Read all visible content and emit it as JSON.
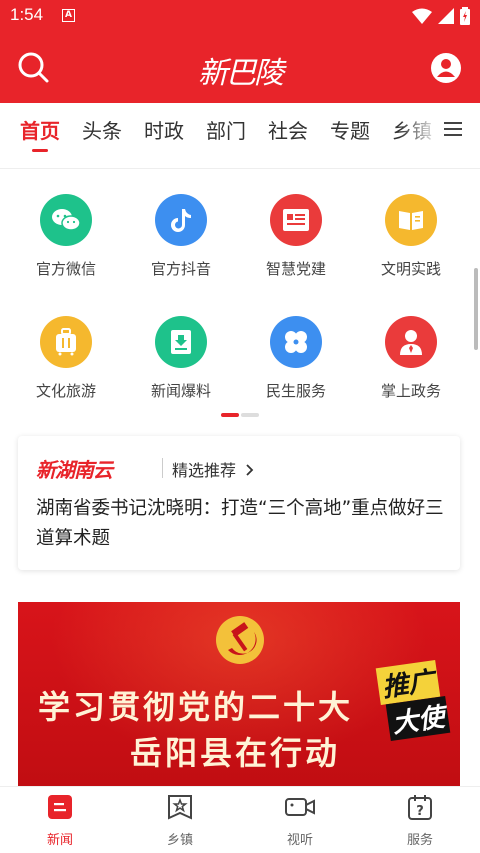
{
  "status_bar": {
    "time": "1:54",
    "notification_icon": "A"
  },
  "header": {
    "logo_text": "新巴陵",
    "search_icon": "search-icon",
    "user_icon": "user-icon",
    "bg_color": "#e8242a"
  },
  "tabs": [
    {
      "label": "首页",
      "active": true
    },
    {
      "label": "头条"
    },
    {
      "label": "时政"
    },
    {
      "label": "部门"
    },
    {
      "label": "社会"
    },
    {
      "label": "专题"
    },
    {
      "label": "乡镇"
    }
  ],
  "grid": [
    {
      "label": "官方微信",
      "icon": "wechat-icon",
      "color": "#1ec28b"
    },
    {
      "label": "官方抖音",
      "icon": "douyin-icon",
      "color": "#3d8ff0"
    },
    {
      "label": "智慧党建",
      "icon": "party-icon",
      "color": "#ea3b3b"
    },
    {
      "label": "文明实践",
      "icon": "book-icon",
      "color": "#f5b82e"
    },
    {
      "label": "文化旅游",
      "icon": "luggage-icon",
      "color": "#f5b82e"
    },
    {
      "label": "新闻爆料",
      "icon": "news-report-icon",
      "color": "#1ec28b"
    },
    {
      "label": "民生服务",
      "icon": "service-icon",
      "color": "#3d8ff0"
    },
    {
      "label": "掌上政务",
      "icon": "government-icon",
      "color": "#ea3b3b"
    }
  ],
  "news_card": {
    "brand": "新湖南云",
    "tag": "精选推荐",
    "title": "湖南省委书记沈晓明：打造“三个高地”重点做好三道算术题"
  },
  "banner": {
    "line1": "学习贯彻党的二十大",
    "line2": "岳阳县在行动",
    "badge_top": "推广",
    "badge_bottom": "大使"
  },
  "bottom_nav": [
    {
      "label": "新闻",
      "icon": "news-icon",
      "active": true
    },
    {
      "label": "乡镇",
      "icon": "town-icon"
    },
    {
      "label": "视听",
      "icon": "video-icon"
    },
    {
      "label": "服务",
      "icon": "service-calendar-icon"
    }
  ]
}
